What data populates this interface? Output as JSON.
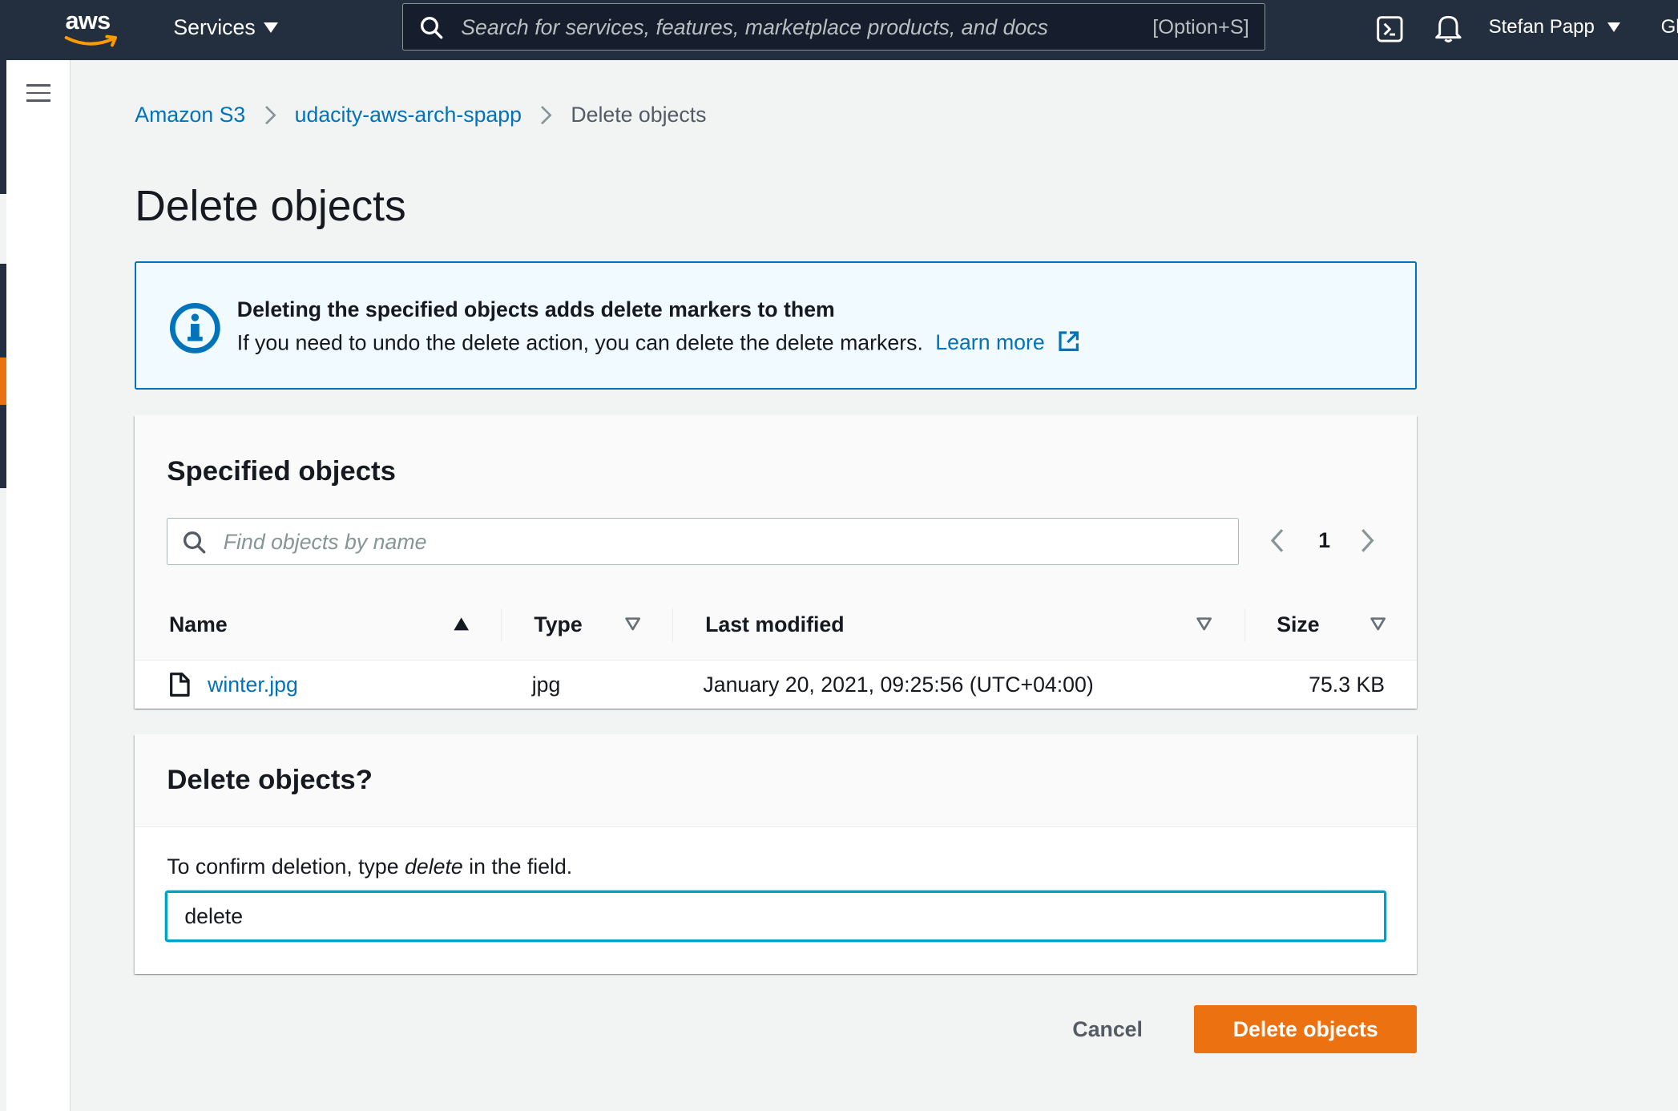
{
  "topbar": {
    "logo_text": "aws",
    "services_label": "Services",
    "search_placeholder": "Search for services, features, marketplace products, and docs",
    "search_shortcut": "[Option+S]",
    "user_name": "Stefan Papp",
    "region_partial": "Gl"
  },
  "breadcrumb": {
    "items": [
      {
        "label": "Amazon S3"
      },
      {
        "label": "udacity-aws-arch-spapp"
      },
      {
        "label": "Delete objects"
      }
    ]
  },
  "page": {
    "title": "Delete objects"
  },
  "alert": {
    "title": "Deleting the specified objects adds delete markers to them",
    "body": "If you need to undo the delete action, you can delete the delete markers.",
    "link": "Learn more"
  },
  "objects_panel": {
    "title": "Specified objects",
    "find_placeholder": "Find objects by name",
    "current_page": "1",
    "columns": [
      "Name",
      "Type",
      "Last modified",
      "Size"
    ],
    "rows": [
      {
        "name": "winter.jpg",
        "type": "jpg",
        "last_modified": "January 20, 2021, 09:25:56 (UTC+04:00)",
        "size": "75.3 KB"
      }
    ]
  },
  "confirm_panel": {
    "title": "Delete objects?",
    "label_prefix": "To confirm deletion, type ",
    "label_keyword": "delete",
    "label_suffix": " in the field.",
    "input_value": "delete"
  },
  "actions": {
    "cancel_label": "Cancel",
    "delete_label": "Delete objects"
  },
  "colors": {
    "topbar": "#232f3e",
    "link": "#0073bb",
    "primary_button": "#ec7211",
    "info_border": "#0073bb",
    "info_background": "#f1faff",
    "focus": "#00a1c9"
  }
}
